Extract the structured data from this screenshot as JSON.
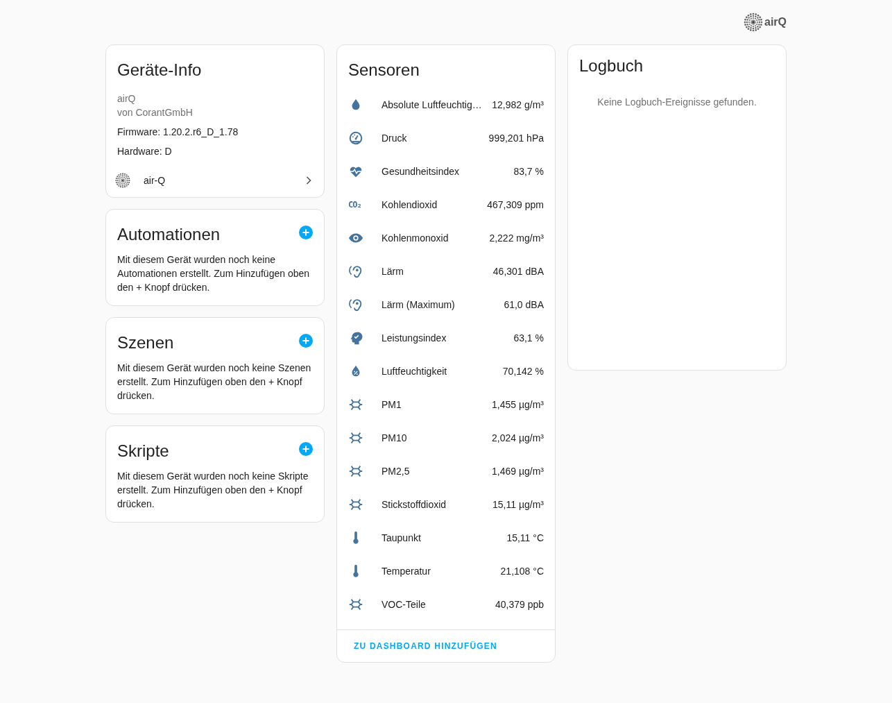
{
  "logo": {
    "text": "airQ"
  },
  "device_info": {
    "title": "Geräte-Info",
    "model": "airQ",
    "manufacturer": "von CorantGmbH",
    "firmware": "Firmware: 1.20.2.r6_D_1.78",
    "hardware": "Hardware: D",
    "link": "air-Q"
  },
  "sections": [
    {
      "title": "Automationen",
      "text": "Mit diesem Gerät wurden noch keine Automationen erstellt. Zum Hinzufügen oben den + Knopf drücken."
    },
    {
      "title": "Szenen",
      "text": "Mit diesem Gerät wurden noch keine Szenen erstellt. Zum Hinzufügen oben den + Knopf drücken."
    },
    {
      "title": "Skripte",
      "text": "Mit diesem Gerät wurden noch keine Skripte erstellt. Zum Hinzufügen oben den + Knopf drücken."
    }
  ],
  "sensors": {
    "title": "Sensoren",
    "items": [
      {
        "kind": "drop",
        "name": "Absolute Luftfeuchtig…",
        "value": "12,982 g/m³"
      },
      {
        "kind": "gauge",
        "name": "Druck",
        "value": "999,201 hPa"
      },
      {
        "kind": "heart",
        "name": "Gesundheitsindex",
        "value": "83,7 %"
      },
      {
        "kind": "text",
        "icon_text": "CO₂",
        "name": "Kohlendioxid",
        "value": "467,309 ppm"
      },
      {
        "kind": "eye",
        "name": "Kohlenmonoxid",
        "value": "2,222 mg/m³"
      },
      {
        "kind": "ear",
        "name": "Lärm",
        "value": "46,301 dBA"
      },
      {
        "kind": "ear",
        "name": "Lärm (Maximum)",
        "value": "61,0 dBA"
      },
      {
        "kind": "head",
        "name": "Leistungsindex",
        "value": "63,1 %"
      },
      {
        "kind": "humidity",
        "name": "Luftfeuchtigkeit",
        "value": "70,142 %"
      },
      {
        "kind": "molecule",
        "name": "PM1",
        "value": "1,455 µg/m³"
      },
      {
        "kind": "molecule",
        "name": "PM10",
        "value": "2,024 µg/m³"
      },
      {
        "kind": "molecule",
        "name": "PM2,5",
        "value": "1,469 µg/m³"
      },
      {
        "kind": "molecule",
        "name": "Stickstoffdioxid",
        "value": "15,11 µg/m³"
      },
      {
        "kind": "thermometer",
        "name": "Taupunkt",
        "value": "15,11 °C"
      },
      {
        "kind": "thermometer",
        "name": "Temperatur",
        "value": "21,108 °C"
      },
      {
        "kind": "molecule",
        "name": "VOC-Teile",
        "value": "40,379 ppb"
      }
    ],
    "action": "ZU DASHBOARD HINZUFÜGEN"
  },
  "logbook": {
    "title": "Logbuch",
    "empty_text": "Keine Logbuch-Ereignisse gefunden."
  }
}
